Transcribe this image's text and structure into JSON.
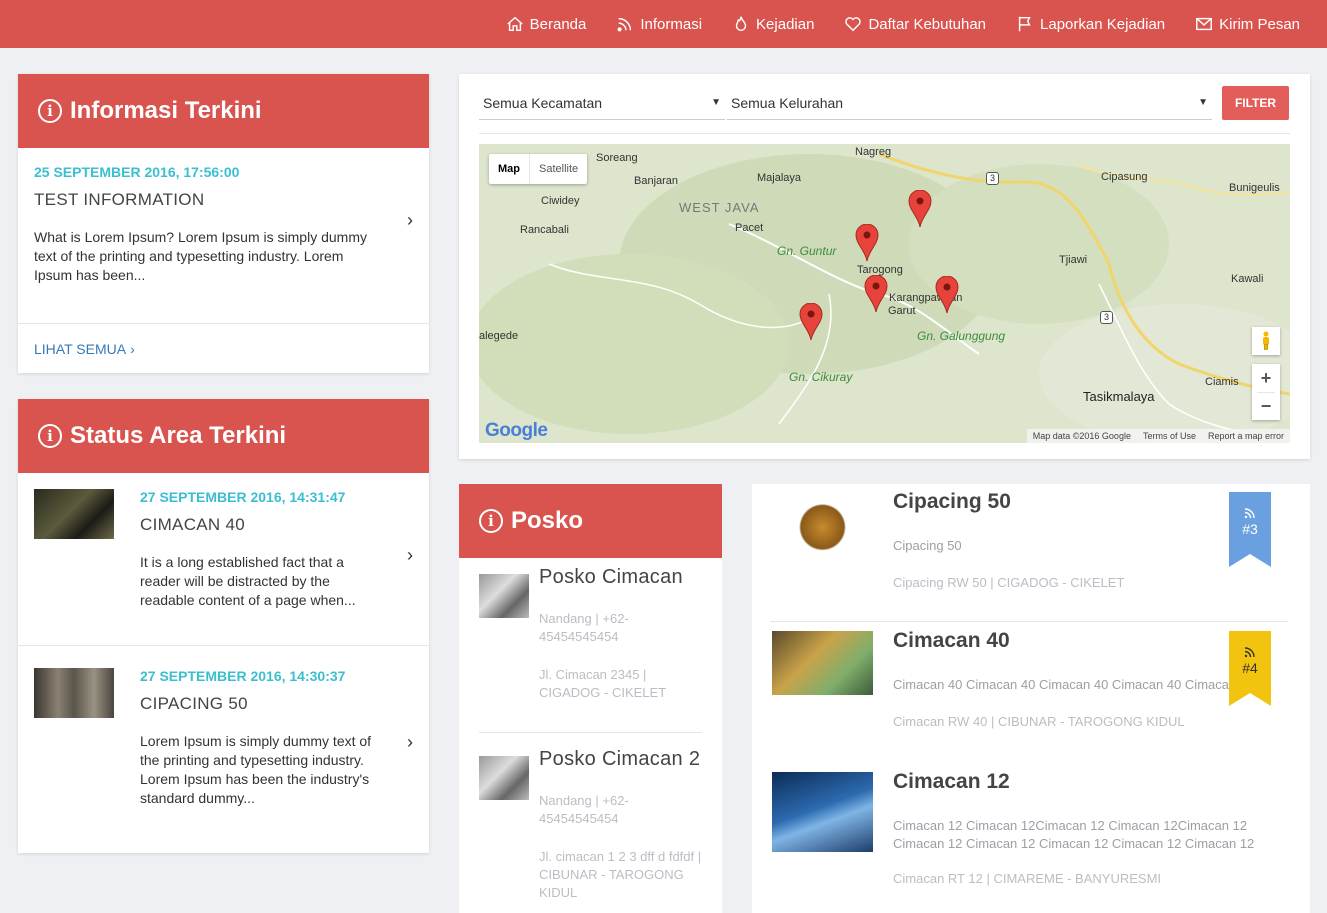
{
  "nav": {
    "items": [
      {
        "label": "Beranda",
        "icon": "home-icon"
      },
      {
        "label": "Informasi",
        "icon": "rss-icon"
      },
      {
        "label": "Kejadian",
        "icon": "fire-icon"
      },
      {
        "label": "Daftar Kebutuhan",
        "icon": "heart-icon"
      },
      {
        "label": "Laporkan Kejadian",
        "icon": "flag-icon"
      },
      {
        "label": "Kirim Pesan",
        "icon": "mail-icon"
      }
    ]
  },
  "info_panel": {
    "title": "Informasi Terkini",
    "item": {
      "date": "25 SEPTEMBER 2016, 17:56:00",
      "title": "TEST INFORMATION",
      "text": "What is Lorem Ipsum? Lorem Ipsum is simply dummy text of the printing and typesetting industry. Lorem Ipsum has been..."
    },
    "see_all": "LIHAT SEMUA"
  },
  "status_panel": {
    "title": "Status Area Terkini",
    "items": [
      {
        "date": "27 SEPTEMBER 2016, 14:31:47",
        "title": "CIMACAN 40",
        "text": "It is a long established fact that a reader will be distracted by the readable content of a page when..."
      },
      {
        "date": "27 SEPTEMBER 2016, 14:30:37",
        "title": "CIPACING 50",
        "text": "Lorem Ipsum is simply dummy text of the printing and typesetting industry. Lorem Ipsum has been the industry's standard dummy..."
      }
    ]
  },
  "map_panel": {
    "kecamatan": "Semua Kecamatan",
    "kelurahan": "Semua Kelurahan",
    "filter": "FILTER",
    "map_btn": "Map",
    "satellite_btn": "Satellite",
    "attribution": "Map data ©2016 Google",
    "terms": "Terms of Use",
    "report": "Report a map error",
    "google": "Google",
    "labels": {
      "soreang": "Soreang",
      "banjaran": "Banjaran",
      "majalaya": "Majalaya",
      "nagreg": "Nagreg",
      "cipasung": "Cipasung",
      "bunigeulis": "Bunigeulis",
      "ciwidey": "Ciwidey",
      "westjava": "WEST JAVA",
      "rancabali": "Rancabali",
      "pacet": "Pacet",
      "guntur": "Gn. Guntur",
      "tarogong": "Tarogong",
      "tjiawi": "Tjiawi",
      "kawali": "Kawali",
      "karangpawitan": "Karangpawitan",
      "garut": "Garut",
      "galunggung": "Gn. Galunggung",
      "talegede": "alegede",
      "cikuray": "Gn. Cikuray",
      "ciamis": "Ciamis",
      "tasikmalaya": "Tasikmalaya",
      "r3a": "3",
      "r3b": "3"
    }
  },
  "posko_panel": {
    "title": "Posko",
    "items": [
      {
        "name": "Posko Cimacan",
        "contact": "Nandang | +62-45454545454",
        "address": "Jl. Cimacan 2345 | CIGADOG - CIKELET"
      },
      {
        "name": "Posko Cimacan 2",
        "contact": "Nandang | +62-45454545454",
        "address": "Jl. cimacan 1 2 3 dff d fdfdf | CIBUNAR - TAROGONG KIDUL"
      }
    ]
  },
  "events": [
    {
      "title": "Cipacing 50",
      "desc": "Cipacing 50",
      "sub": "Cipacing RW 50 | CIGADOG - CIKELET",
      "badge": "#3",
      "badge_color": "#6a9fe0"
    },
    {
      "title": "Cimacan 40",
      "desc": "Cimacan 40 Cimacan 40 Cimacan 40 Cimacan 40 Cimaca",
      "sub": "Cimacan RW 40 | CIBUNAR - TAROGONG KIDUL",
      "badge": "#4",
      "badge_color": "#f2c40f"
    },
    {
      "title": "Cimacan 12",
      "desc": "Cimacan 12 Cimacan 12Cimacan 12 Cimacan 12Cimacan 12 Cimacan 12 Cimacan 12 Cimacan 12 Cimacan 12 Cimacan 12",
      "sub": "Cimacan RT 12 | CIMAREME - BANYURESMI"
    }
  ]
}
